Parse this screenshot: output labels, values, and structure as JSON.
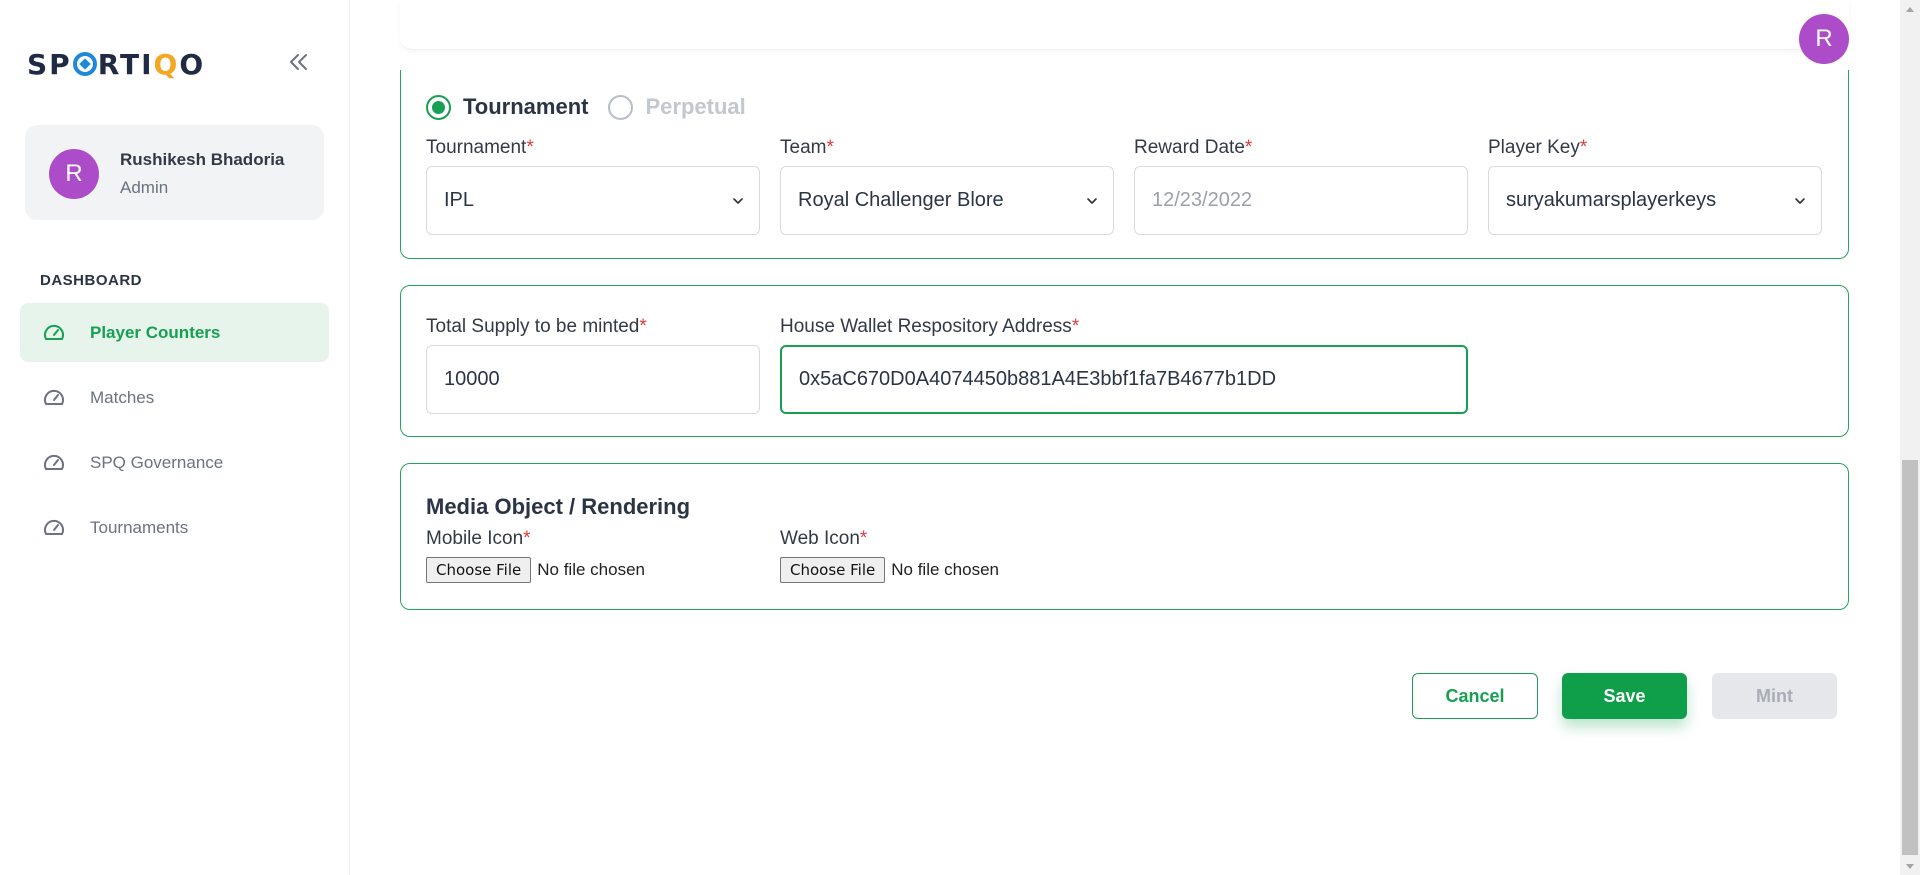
{
  "brand": {
    "logo_text_start": "SP",
    "logo_text_mid": "RTI",
    "logo_text_q": "Q",
    "logo_text_end": "O",
    "accent": "#18a052"
  },
  "user": {
    "initial": "R",
    "name": "Rushikesh Bhadoria",
    "role": "Admin",
    "avatar_color": "#ad4cc9"
  },
  "sidebar": {
    "section_label": "DASHBOARD",
    "items": [
      {
        "label": "Player Counters",
        "icon": "speedometer-icon",
        "active": true
      },
      {
        "label": "Matches",
        "icon": "speedometer-icon",
        "active": false
      },
      {
        "label": "SPQ Governance",
        "icon": "speedometer-icon",
        "active": false
      },
      {
        "label": "Tournaments",
        "icon": "speedometer-icon",
        "active": false
      }
    ]
  },
  "form": {
    "type_options": [
      {
        "label": "Tournament",
        "selected": true
      },
      {
        "label": "Perpetual",
        "selected": false
      }
    ],
    "tournament": {
      "label": "Tournament",
      "required": "*",
      "value": "IPL"
    },
    "team": {
      "label": "Team",
      "required": "*",
      "value": "Royal Challenger Blore"
    },
    "reward_date": {
      "label": "Reward Date",
      "required": "*",
      "placeholder": "12/23/2022"
    },
    "player_key": {
      "label": "Player Key",
      "required": "*",
      "value": "suryakumarsplayerkeys"
    },
    "total_supply": {
      "label": "Total Supply to be minted",
      "required": "*",
      "value": "10000"
    },
    "wallet": {
      "label": "House Wallet Respository Address",
      "required": "*",
      "value": "0x5aC670D0A4074450b881A4E3bbf1fa7B4677b1DD"
    },
    "media": {
      "title": "Media Object / Rendering",
      "mobile_icon": {
        "label": "Mobile Icon",
        "required": "*",
        "button": "Choose File",
        "status": "No file chosen"
      },
      "web_icon": {
        "label": "Web Icon",
        "required": "*",
        "button": "Choose File",
        "status": "No file chosen"
      }
    }
  },
  "actions": {
    "cancel": "Cancel",
    "save": "Save",
    "mint": "Mint"
  }
}
